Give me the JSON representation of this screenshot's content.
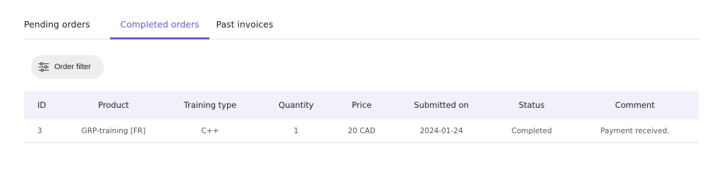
{
  "tabs": [
    {
      "label": "Pending orders",
      "active": false
    },
    {
      "label": "Completed orders",
      "active": true
    },
    {
      "label": "Past invoices",
      "active": false
    }
  ],
  "filter": {
    "label": "Order filter",
    "icon": "sliders-icon"
  },
  "colors": {
    "accent": "#7355d6",
    "header_bg": "#f1f0fb",
    "filter_bg": "#eceef0"
  },
  "table": {
    "columns": [
      "ID",
      "Product",
      "Training type",
      "Quantity",
      "Price",
      "Submitted on",
      "Status",
      "Comment"
    ],
    "rows": [
      [
        "3",
        "GRP-training [FR]",
        "C++",
        "1",
        "20 CAD",
        "2024-01-24",
        "Completed",
        "Payment received."
      ]
    ]
  }
}
